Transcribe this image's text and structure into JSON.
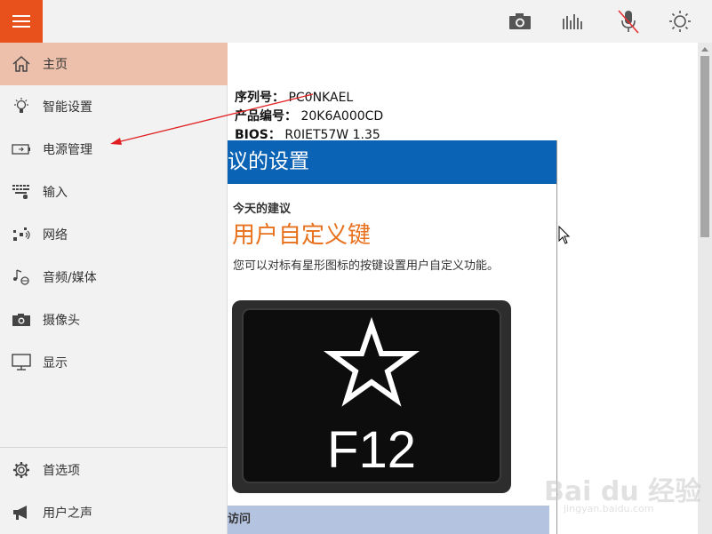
{
  "colors": {
    "accent": "#e8511b",
    "nav_active": "#ecc0aa",
    "panel_header": "#0b63b6",
    "suggestion_title": "#e8711e",
    "visit_bar": "#b4c3e0",
    "annotation_arrow": "#e02020"
  },
  "topbar": {
    "icons": [
      "menu-icon",
      "camera-icon",
      "audio-levels-icon",
      "microphone-muted-icon",
      "brightness-icon"
    ]
  },
  "sidebar": {
    "items": [
      {
        "label": "主页",
        "icon": "home-icon",
        "active": true
      },
      {
        "label": "智能设置",
        "icon": "lightbulb-icon",
        "active": false
      },
      {
        "label": "电源管理",
        "icon": "battery-icon",
        "active": false
      },
      {
        "label": "输入",
        "icon": "keyboard-icon",
        "active": false
      },
      {
        "label": "网络",
        "icon": "network-icon",
        "active": false
      },
      {
        "label": "音频/媒体",
        "icon": "music-note-icon",
        "active": false
      },
      {
        "label": "摄像头",
        "icon": "camera-icon",
        "active": false
      },
      {
        "label": "显示",
        "icon": "monitor-icon",
        "active": false
      }
    ],
    "bottom_items": [
      {
        "label": "首选项",
        "icon": "gear-icon"
      },
      {
        "label": "用户之声",
        "icon": "megaphone-icon"
      }
    ]
  },
  "device_info": {
    "serial_label": "序列号：",
    "serial_value": "PC0NKAEL",
    "product_label": "产品编号：",
    "product_value": "20K6A000CD",
    "bios_label": "BIOS：",
    "bios_value": "R0IET57W 1.35"
  },
  "panel": {
    "header": "议的设置",
    "suggestion_label": "今天的建议",
    "suggestion_title": "用户自定义键",
    "suggestion_desc": "您可以对标有星形图标的按键设置用户自定义功能。",
    "key_label": "F12",
    "visit_label": "访问"
  },
  "watermark": {
    "logo": "Bai du 经验",
    "url": "jingyan.baidu.com"
  }
}
